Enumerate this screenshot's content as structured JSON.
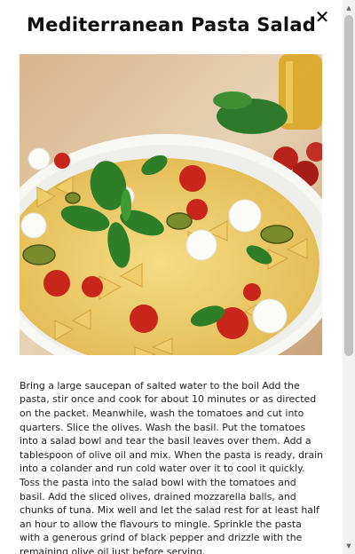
{
  "recipe": {
    "title": "Mediterranean Pasta Salad",
    "close_symbol": "✕",
    "image_alt": "Pasta salad with tomatoes, mozzarella, olives and basil",
    "description": "Bring a large saucepan of salted water to the boil Add the pasta, stir once and cook for about 10 minutes or as directed on the packet. Meanwhile, wash the tomatoes and cut into quarters. Slice the olives. Wash the basil. Put the tomatoes into a salad bowl and tear the basil leaves over them. Add a tablespoon of olive oil and mix. When the pasta is ready, drain into a colander and run cold water over it to cool it quickly. Toss the pasta into the salad bowl with the tomatoes and basil. Add the sliced olives, drained mozzarella balls, and chunks of tuna. Mix well and let the salad rest for at least half an hour to allow the flavours to mingle. Sprinkle the pasta with a generous grind of black pepper and drizzle with the remaining olive oil just before serving."
  },
  "scrollbar": {
    "up_arrow": "▲",
    "down_arrow": "▼"
  },
  "colors": {
    "background": "#ffffff",
    "title": "#111111",
    "text": "#222222",
    "scroll_thumb": "#c1c1c1"
  },
  "icons": [
    "close-icon",
    "scroll-up-arrow-icon",
    "scroll-down-arrow-icon"
  ]
}
